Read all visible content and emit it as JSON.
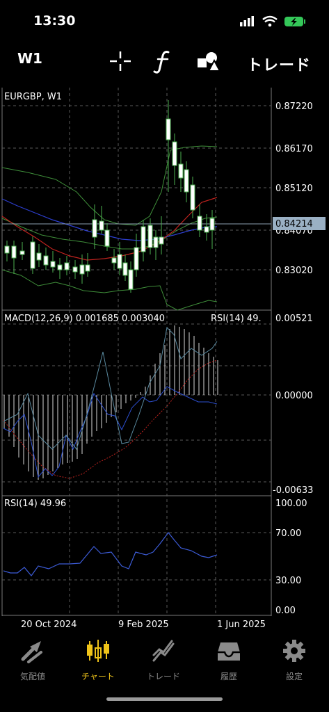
{
  "status": {
    "time": "13:30"
  },
  "toolbar": {
    "timeframe": "W1",
    "trade_label": "トレード"
  },
  "chart": {
    "symbol_label": "EURGBP, W1",
    "macd_label": "MACD(12,26,9) 0.001685 0.003040",
    "macd_rsi_overlay": "RSI(14) 49.",
    "rsi_label": "RSI(14) 49.96",
    "current_price": "0.84214",
    "price_axis": [
      "0.87220",
      "0.86170",
      "0.85120",
      "0.84070",
      "0.83020"
    ],
    "macd_axis": [
      "0.00521",
      "0.00000",
      "-0.00633"
    ],
    "rsi_axis": [
      "100.00",
      "70.00",
      "30.00",
      "0.00"
    ],
    "time_axis": [
      "20 Oct 2024",
      "9 Feb 2025",
      "1 Jun 2025"
    ]
  },
  "tabs": [
    {
      "label": "気配値",
      "icon": "quotes-icon"
    },
    {
      "label": "チャート",
      "icon": "chart-icon"
    },
    {
      "label": "トレード",
      "icon": "trade-icon"
    },
    {
      "label": "履歴",
      "icon": "history-icon"
    },
    {
      "label": "設定",
      "icon": "settings-icon"
    }
  ],
  "colors": {
    "accent": "#f0c419",
    "grid": "#6a6a6a",
    "bb": "#3f8f3a",
    "ma_red": "#c0231f",
    "ma_blue": "#2d3fd1",
    "rsi": "#3c5bd6"
  }
}
